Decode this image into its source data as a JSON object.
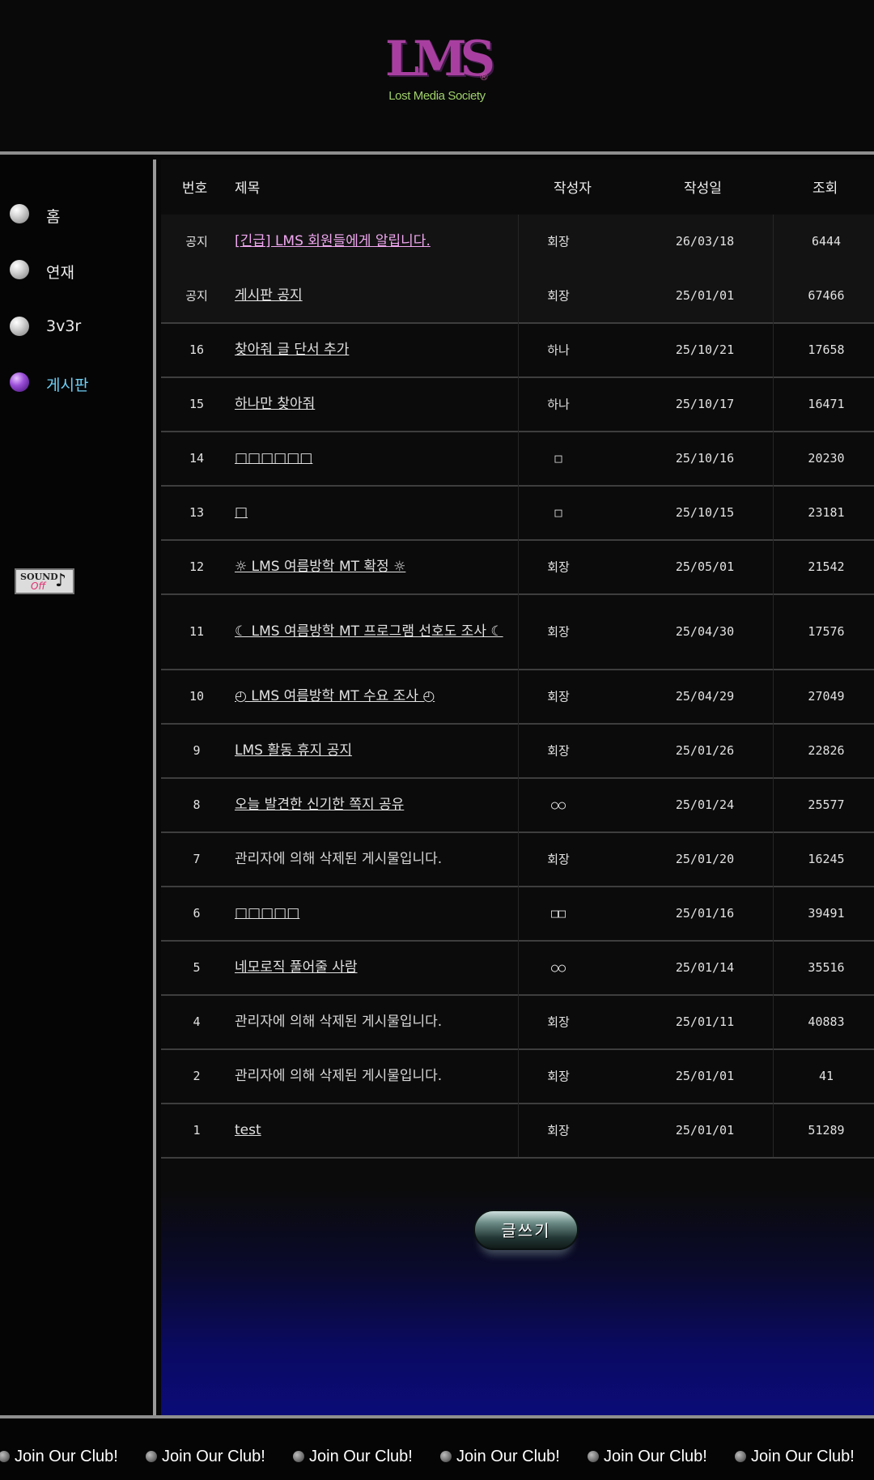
{
  "brand": {
    "logo_text": "LMS",
    "registered_mark": "®",
    "tagline": "Lost Media Society"
  },
  "sidebar": {
    "items": [
      {
        "label": "홈",
        "active": false
      },
      {
        "label": "연재",
        "active": false
      },
      {
        "label": "3v3r",
        "active": false
      },
      {
        "label": "게시판",
        "active": true
      }
    ],
    "sound_button": {
      "line1": "SOUND",
      "line2": "Off",
      "icon": "music-note-icon"
    }
  },
  "board": {
    "columns": {
      "num": "번호",
      "title": "제목",
      "author": "작성자",
      "date": "작성일",
      "views": "조회"
    },
    "rows": [
      {
        "num": "공지",
        "title": "[긴급] LMS 회원들에게 알립니다.",
        "author": "회장",
        "date": "26/03/18",
        "views": "6444"
      },
      {
        "num": "공지",
        "title": "게시판 공지",
        "author": "회장",
        "date": "25/01/01",
        "views": "67466"
      },
      {
        "num": "16",
        "title": "찾아줘 글 단서 추가",
        "author": "하나",
        "date": "25/10/21",
        "views": "17658"
      },
      {
        "num": "15",
        "title": "하나만 찾아줘",
        "author": "하나",
        "date": "25/10/17",
        "views": "16471"
      },
      {
        "num": "14",
        "title": "□□□□□□",
        "author": "□",
        "date": "25/10/16",
        "views": "20230"
      },
      {
        "num": "13",
        "title": "□",
        "author": "□",
        "date": "25/10/15",
        "views": "23181"
      },
      {
        "num": "12",
        "title": "☼ LMS 여름방학 MT 확정 ☼",
        "author": "회장",
        "date": "25/05/01",
        "views": "21542"
      },
      {
        "num": "11",
        "title": "☾ LMS 여름방학 MT 프로그램 선호도 조사 ☾",
        "author": "회장",
        "date": "25/04/30",
        "views": "17576"
      },
      {
        "num": "10",
        "title": "◴ LMS 여름방학 MT 수요 조사 ◴",
        "author": "회장",
        "date": "25/04/29",
        "views": "27049"
      },
      {
        "num": "9",
        "title": "LMS 활동 휴지 공지",
        "author": "회장",
        "date": "25/01/26",
        "views": "22826"
      },
      {
        "num": "8",
        "title": "오늘 발견한 신기한 쪽지 공유",
        "author": "○○",
        "date": "25/01/24",
        "views": "25577"
      },
      {
        "num": "7",
        "title": "관리자에 의해 삭제된 게시물입니다.",
        "author": "회장",
        "date": "25/01/20",
        "views": "16245"
      },
      {
        "num": "6",
        "title": "□□□□□",
        "author": "□□",
        "date": "25/01/16",
        "views": "39491"
      },
      {
        "num": "5",
        "title": "네모로직 풀어줄 사람",
        "author": "○○",
        "date": "25/01/14",
        "views": "35516"
      },
      {
        "num": "4",
        "title": "관리자에 의해 삭제된 게시물입니다.",
        "author": "회장",
        "date": "25/01/11",
        "views": "40883"
      },
      {
        "num": "2",
        "title": "관리자에 의해 삭제된 게시물입니다.",
        "author": "회장",
        "date": "25/01/01",
        "views": "41"
      },
      {
        "num": "1",
        "title": "test",
        "author": "회장",
        "date": "25/01/01",
        "views": "51289"
      }
    ],
    "write_button": "글쓰기"
  },
  "footer": {
    "marquee_text": "Join Our Club!",
    "marquee_icon": "globe-icon"
  },
  "colors": {
    "active_nav": "#6fd0f5",
    "urgent_title": "#f0a8f0",
    "logo_purple": "#a83fa0",
    "logo_green": "#9fd06a"
  }
}
